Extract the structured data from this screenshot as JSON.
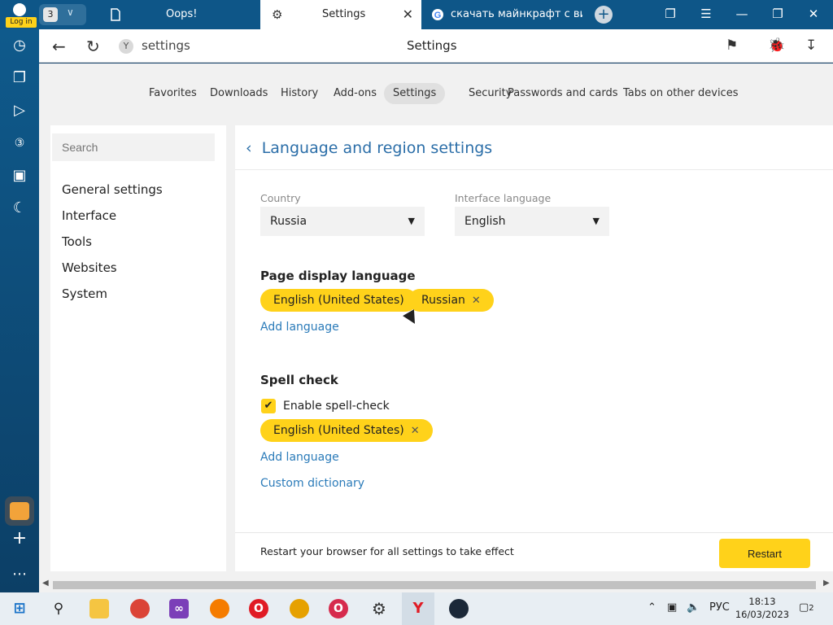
{
  "login": {
    "label": "Log in"
  },
  "tab_group": {
    "count": "3"
  },
  "tabs": [
    {
      "title": "Oops!"
    },
    {
      "title": "Settings"
    },
    {
      "title": "скачать майнкрафт с вир"
    }
  ],
  "address": {
    "url": "settings",
    "page_title": "Settings"
  },
  "top_nav": [
    "Favorites",
    "Downloads",
    "History",
    "Add-ons",
    "Settings",
    "Security",
    "Passwords and cards",
    "Tabs on other devices"
  ],
  "sidebar": {
    "search_placeholder": "Search",
    "items": [
      "General settings",
      "Interface",
      "Tools",
      "Websites",
      "System"
    ]
  },
  "section": {
    "title": "Language and region settings"
  },
  "country": {
    "label": "Country",
    "value": "Russia"
  },
  "interface_language": {
    "label": "Interface language",
    "value": "English"
  },
  "page_display": {
    "heading": "Page display language",
    "chips": [
      "English (United States)",
      "Russian"
    ],
    "add_language": "Add language"
  },
  "spell_check": {
    "heading": "Spell check",
    "enable_label": "Enable spell-check",
    "enabled": true,
    "chips": [
      "English (United States)"
    ],
    "add_language": "Add language",
    "custom_dictionary": "Custom dictionary"
  },
  "restart": {
    "message": "Restart your browser for all settings to take effect",
    "button": "Restart"
  },
  "taskbar": {
    "language": "РУС",
    "time": "18:13",
    "date": "16/03/2023",
    "notifications": "2"
  },
  "colors": {
    "accent": "#ffd21a",
    "link": "#2b7bb9",
    "chrome": "#0e5688"
  }
}
